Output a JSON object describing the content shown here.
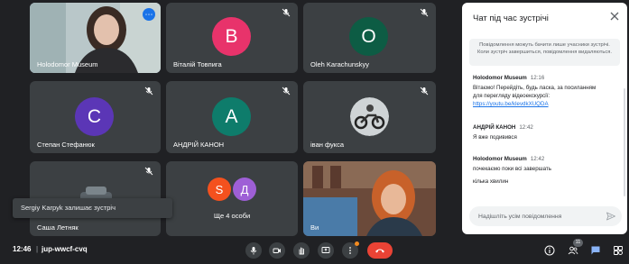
{
  "participants": [
    {
      "name": "Holodomor Museum",
      "type": "photo"
    },
    {
      "name": "Віталій Товпига",
      "initial": "B",
      "color": "#e8336b"
    },
    {
      "name": "Oleh Karachunskyy",
      "initial": "O",
      "color": "#0d5c44"
    },
    {
      "name": "Степан Стефанюк",
      "initial": "C",
      "color": "#5b36b6"
    },
    {
      "name": "АНДРІЙ КАНОН",
      "initial": "A",
      "color": "#0e7c6b"
    },
    {
      "name": "іван фукса",
      "type": "photo"
    },
    {
      "name": "Саша Летняк",
      "type": "photo"
    },
    {
      "name": "Ще 4 особи",
      "initials": [
        "S",
        "Д"
      ],
      "colors": [
        "#f4511e",
        "#9e5fd6"
      ]
    },
    {
      "name": "Ви",
      "type": "photo"
    }
  ],
  "toast": "Sergiy Karpyk залишає зустріч",
  "bottom_bar": {
    "time": "12:46",
    "separator": "|",
    "meeting_code": "jup-wwcf-cvq",
    "people_count": "11"
  },
  "chat": {
    "title": "Чат під час зустрічі",
    "notice": "Повідомлення можуть бачити лише учасники зустрічі. Коли зустріч завершиться, повідомлення видаляються.",
    "messages": [
      {
        "sender": "Holodomor Museum",
        "time": "12:16",
        "lines": [
          "Вітаємо! Перейдіть, будь ласка, за посиланням",
          "для перегляду відеоекскурсії:"
        ],
        "link": "https://youtu.be/klevdkXUQDA"
      },
      {
        "sender": "АНДРІЙ КАНОН",
        "time": "12:42",
        "lines": [
          "Я вже подивився"
        ]
      },
      {
        "sender": "Holodomor Museum",
        "time": "12:42",
        "lines": [
          "почекаємо поки всі завершать",
          "кілька хвилин"
        ]
      }
    ],
    "input_placeholder": "Надішліть усім повідомлення"
  },
  "icons": {
    "mic": "mic-icon",
    "camera": "camera-icon",
    "hand": "raise-hand-icon",
    "present": "present-screen-icon",
    "more": "more-options-icon",
    "hangup": "hang-up-icon",
    "info": "info-icon",
    "people": "people-icon",
    "chat": "chat-icon",
    "activities": "activities-icon",
    "close": "close-icon",
    "send": "send-icon"
  },
  "colors": {
    "background": "#202124",
    "tile": "#3c4043",
    "hangup": "#ea4335",
    "accent": "#1a73e8",
    "active_chat_icon": "#8ab4f8"
  }
}
